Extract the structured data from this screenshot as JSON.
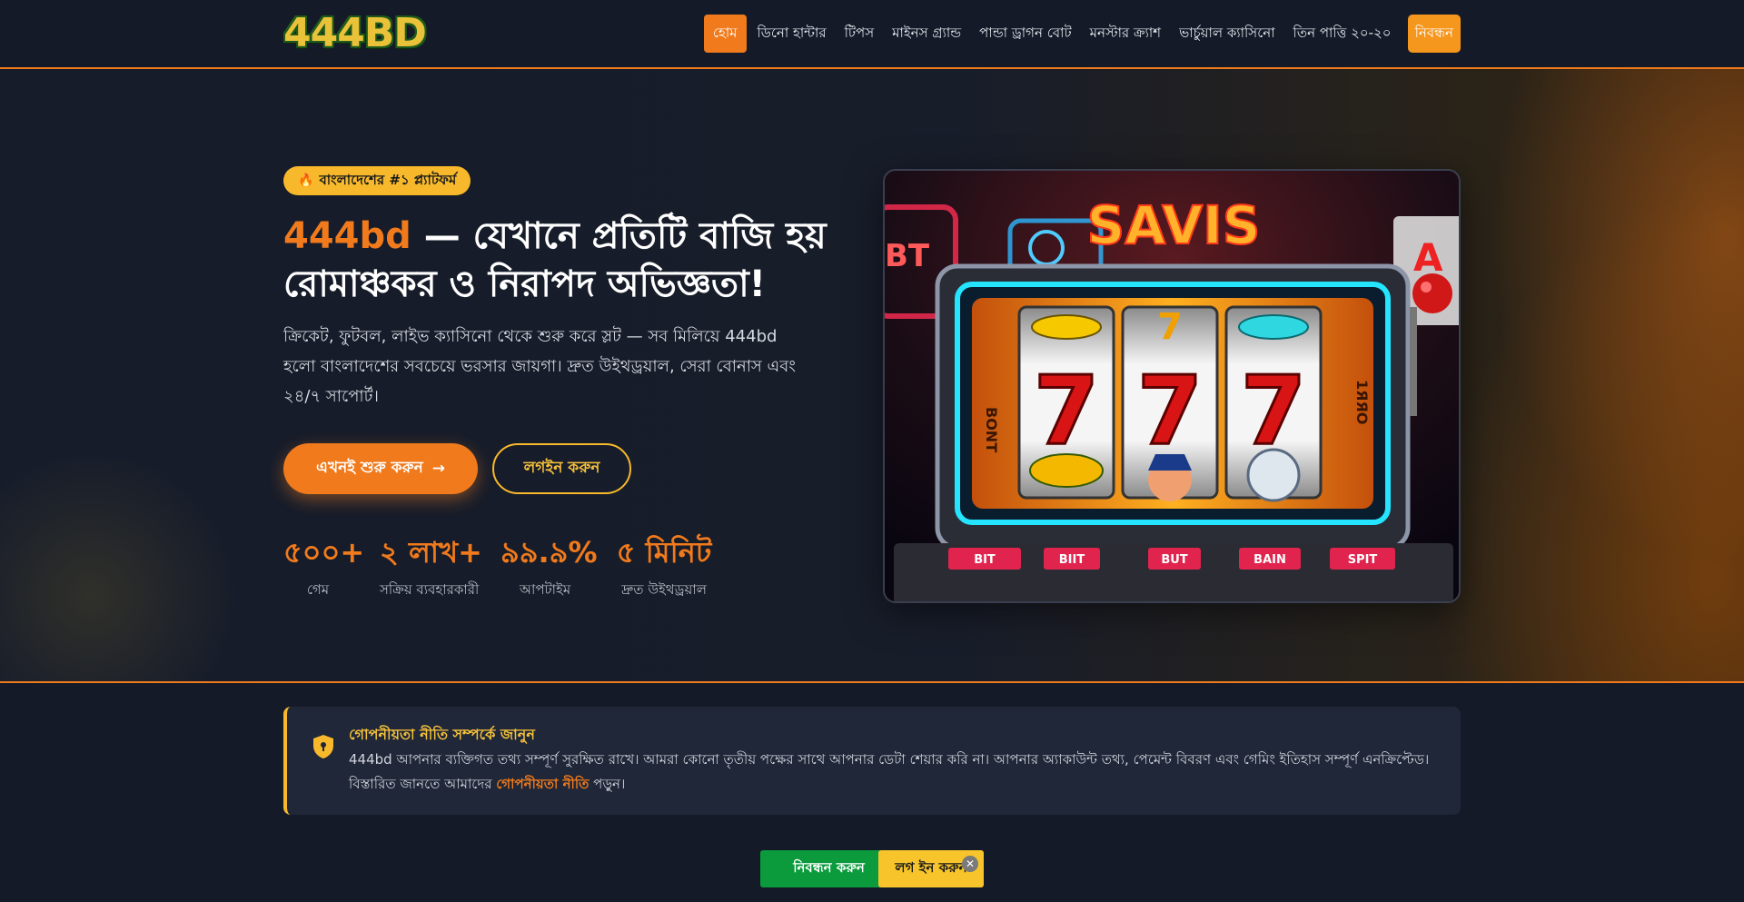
{
  "header": {
    "logo": "444BD",
    "nav": [
      {
        "label": "হোম",
        "active": true
      },
      {
        "label": "ডিনো হান্টার"
      },
      {
        "label": "টিপস"
      },
      {
        "label": "মাইনস গ্র্যান্ড"
      },
      {
        "label": "পান্ডা ড্রাগন বোট"
      },
      {
        "label": "মনস্টার ক্র্যাশ"
      },
      {
        "label": "ভার্চুয়াল ক্যাসিনো"
      },
      {
        "label": "তিন পাত্তি ২০-২০"
      }
    ],
    "register_label": "নিবন্ধন"
  },
  "hero": {
    "badge": "বাংলাদেশের #১ প্ল্যাটফর্ম",
    "badge_icon": "fire-icon",
    "title_brand": "444bd",
    "title_rest": " — যেখানে প্রতিটি বাজি হয় রোমাঞ্চকর ও নিরাপদ অভিজ্ঞতা!",
    "description": "ক্রিকেট, ফুটবল, লাইভ ক্যাসিনো থেকে শুরু করে স্লট — সব মিলিয়ে 444bd হলো বাংলাদেশের সবচেয়ে ভরসার জায়গা। দ্রুত উইথড্রয়াল, সেরা বোনাস এবং ২৪/৭ সাপোর্ট।",
    "start_button": "এখনই শুরু করুন",
    "start_arrow": "→",
    "login_button": "লগইন করুন",
    "stats": [
      {
        "value": "৫০০+",
        "label": "গেম"
      },
      {
        "value": "২ লাখ+",
        "label": "সক্রিয় ব্যবহারকারী"
      },
      {
        "value": "৯৯.৯%",
        "label": "আপটাইম"
      },
      {
        "value": "৫ মিনিট",
        "label": "দ্রুত উইথড্রয়াল"
      }
    ],
    "image": {
      "neon_sign": "SAVIS",
      "reel_symbol": "7",
      "side_left": "BONT",
      "side_right": "1ЯЯО",
      "neon_left": "BT",
      "neon_right": "A",
      "keys": [
        "BIT",
        "BIIT",
        "BUT",
        "BAIN",
        "SPIT"
      ]
    }
  },
  "privacy": {
    "icon": "shield-lock-icon",
    "title": "গোপনীয়তা নীতি সম্পর্কে জানুন",
    "text": "444bd আপনার ব্যক্তিগত তথ্য সম্পূর্ণ সুরক্ষিত রাখে। আমরা কোনো তৃতীয় পক্ষের সাথে আপনার ডেটা শেয়ার করি না। আপনার অ্যাকাউন্ট তথ্য, পেমেন্ট বিবরণ এবং গেমিং ইতিহাস সম্পূর্ণ এনক্রিপ্টেড।",
    "more_prefix": "বিস্তারিত জানতে আমাদের ",
    "link_text": "গোপনীয়তা নীতি",
    "more_suffix": " পড়ুন।"
  },
  "cta": {
    "register": "নিবন্ধন করুন",
    "login": "লগ ইন করুন",
    "close": "✕"
  },
  "colors": {
    "accent_orange": "#f07a1c",
    "accent_yellow": "#f7b92b",
    "cta_green": "#0b9a3c",
    "background": "#141a28"
  }
}
